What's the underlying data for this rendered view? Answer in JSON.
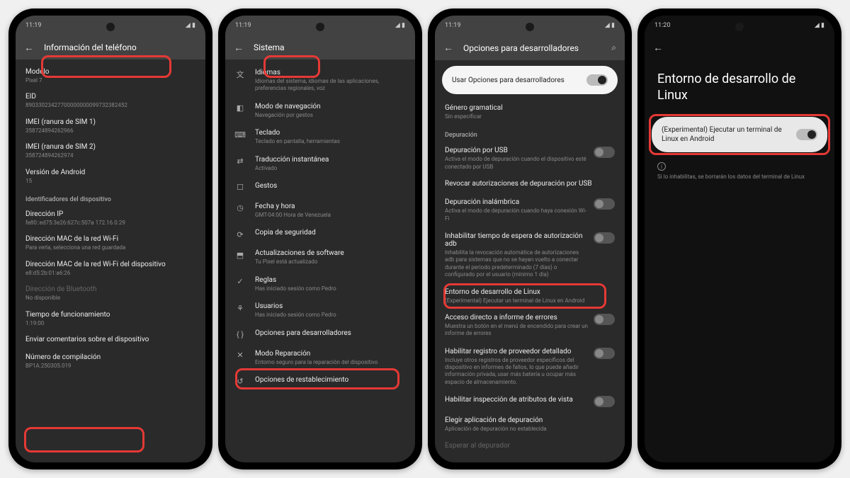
{
  "status": {
    "time1": "11:19",
    "time2": "11:20",
    "icons": "◢ ▮"
  },
  "phone1": {
    "header": "Información del teléfono",
    "items": [
      {
        "t": "Modelo",
        "s": "Pixel 7"
      },
      {
        "t": "EID",
        "s": "89033023427700000000099732382452"
      },
      {
        "t": "IMEI (ranura de SIM 1)",
        "s": "358724894262966"
      },
      {
        "t": "IMEI (ranura de SIM 2)",
        "s": "358724894262974"
      },
      {
        "t": "Versión de Android",
        "s": "15"
      }
    ],
    "section": "Identificadores del dispositivo",
    "items2": [
      {
        "t": "Dirección IP",
        "s": "fe80::ed75:3e26:627c:507a\n172.16.0.29"
      },
      {
        "t": "Dirección MAC de la red Wi-Fi",
        "s": "Para verla, selecciona una red guardada"
      },
      {
        "t": "Dirección MAC de la red Wi-Fi del dispositivo",
        "s": "e8:d5:2b:01:a6:26"
      },
      {
        "t": "Dirección de Bluetooth",
        "s": "No disponible",
        "dim": true
      },
      {
        "t": "Tiempo de funcionamiento",
        "s": "1:19:00"
      },
      {
        "t": "Enviar comentarios sobre el dispositivo",
        "s": ""
      },
      {
        "t": "Número de compilación",
        "s": "BP1A.250305.019"
      }
    ]
  },
  "phone2": {
    "header": "Sistema",
    "items": [
      {
        "icon": "文",
        "t": "Idiomas",
        "s": "Idiomas del sistema, idiomas de las aplicaciones, preferencias regionales, voz"
      },
      {
        "icon": "◧",
        "t": "Modo de navegación",
        "s": "Navegación por gestos"
      },
      {
        "icon": "⌨",
        "t": "Teclado",
        "s": "Teclado en pantalla, herramientas"
      },
      {
        "icon": "⇄",
        "t": "Traducción instantánea",
        "s": "Activado"
      },
      {
        "icon": "☐",
        "t": "Gestos",
        "s": ""
      },
      {
        "icon": "◷",
        "t": "Fecha y hora",
        "s": "GMT-04:00 Hora de Venezuela"
      },
      {
        "icon": "⟳",
        "t": "Copia de seguridad",
        "s": ""
      },
      {
        "icon": "⬒",
        "t": "Actualizaciones de software",
        "s": "Tu Pixel está actualizado"
      },
      {
        "icon": "✓",
        "t": "Reglas",
        "s": "Has iniciado sesión como Pedro"
      },
      {
        "icon": "⚘",
        "t": "Usuarios",
        "s": "Has iniciado sesión como Pedro"
      },
      {
        "icon": "{ }",
        "t": "Opciones para desarrolladores",
        "s": ""
      },
      {
        "icon": "✕",
        "t": "Modo Reparación",
        "s": "Entorno seguro para la reparación del dispositivo"
      },
      {
        "icon": "↺",
        "t": "Opciones de restablecimiento",
        "s": ""
      }
    ]
  },
  "phone3": {
    "header": "Opciones para desarrolladores",
    "toggle": "Usar Opciones para desarrolladores",
    "top": [
      {
        "t": "Género gramatical",
        "s": "Sin especificar"
      }
    ],
    "section": "Depuración",
    "items": [
      {
        "t": "Depuración por USB",
        "s": "Activa el modo de depuración cuando el dispositivo esté conectado por USB",
        "sw": "off"
      },
      {
        "t": "Revocar autorizaciones de depuración por USB",
        "s": ""
      },
      {
        "t": "Depuración inalámbrica",
        "s": "Activa el modo de depuración cuando haya conexión Wi-Fi",
        "sw": "off"
      },
      {
        "t": "Inhabilitar tiempo de espera de autorización adb",
        "s": "Inhabilita la revocación automática de autorizaciones adb para sistemas que no se hayan vuelto a conectar durante el periodo predeterminado (7 días) o configurado por el usuario (mínimo 1 día)",
        "sw": "off"
      },
      {
        "t": "Entorno de desarrollo de Linux",
        "s": "(Experimental) Ejecutar un terminal de Linux en Android"
      },
      {
        "t": "Acceso directo a informe de errores",
        "s": "Muestra un botón en el menú de encendido para crear un informe de errores",
        "sw": "off"
      },
      {
        "t": "Habilitar registro de proveedor detallado",
        "s": "Incluye otros registros de proveedor específicos del dispositivo en informes de fallos, lo que puede añadir información privada, usar más batería u ocupar más espacio de almacenamiento.",
        "sw": "off"
      },
      {
        "t": "Habilitar inspección de atributos de vista",
        "s": "",
        "sw": "off"
      },
      {
        "t": "Elegir aplicación de depuración",
        "s": "Aplicación de depuración no establecida"
      },
      {
        "t": "Esperar al depurador",
        "s": ""
      }
    ]
  },
  "phone4": {
    "title": "Entorno de desarrollo de Linux",
    "toggle": "(Experimental) Ejecutar un terminal de Linux en Android",
    "info": "Si lo inhabilitas, se borrarán los datos del terminal de Linux"
  }
}
